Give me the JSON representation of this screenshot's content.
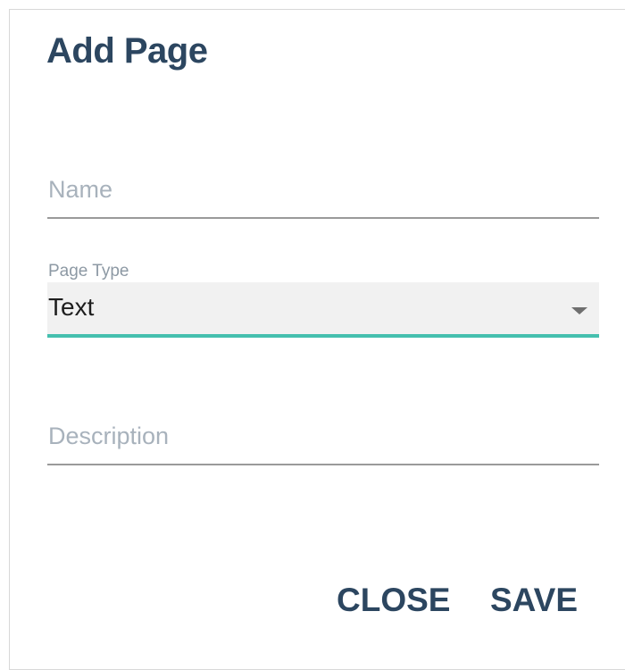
{
  "dialog": {
    "title": "Add Page"
  },
  "form": {
    "name_placeholder": "Name",
    "page_type_label": "Page Type",
    "page_type_value": "Text",
    "description_placeholder": "Description"
  },
  "actions": {
    "close_label": "CLOSE",
    "save_label": "SAVE"
  },
  "colors": {
    "title": "#2c4660",
    "select_focus_underline": "#45bfae",
    "placeholder": "#a8b2bc"
  }
}
